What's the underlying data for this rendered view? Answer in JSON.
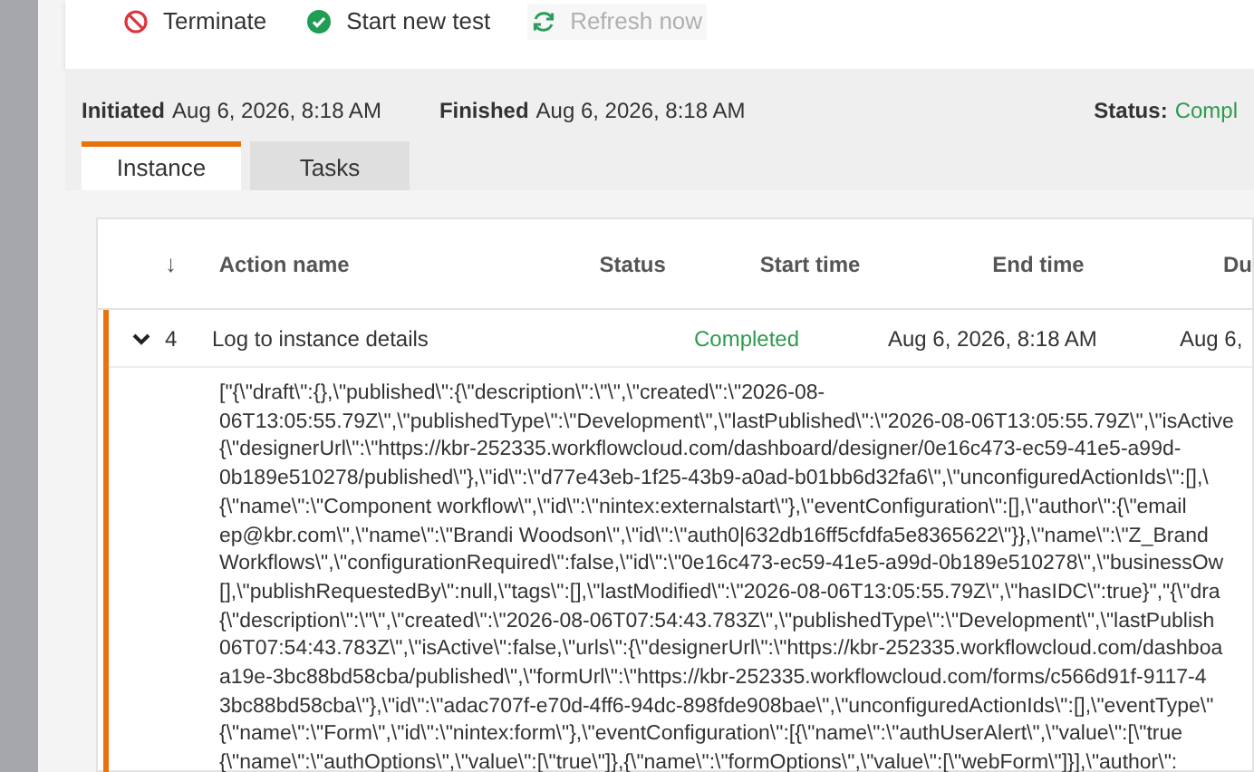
{
  "toolbar": [
    {
      "kind": "terminate",
      "label": "Terminate",
      "disabled": false
    },
    {
      "kind": "start",
      "label": "Start new test",
      "disabled": false
    },
    {
      "kind": "refresh",
      "label": "Refresh now",
      "disabled": true
    }
  ],
  "summary": {
    "initiated_label": "Initiated",
    "initiated": "Aug 6, 2026, 8:18 AM",
    "finished_label": "Finished",
    "finished": "Aug 6, 2026, 8:18 AM",
    "status_label": "Status:",
    "status": "Compl"
  },
  "tabs": [
    {
      "label": "Instance",
      "selected": true
    },
    {
      "label": "Tasks",
      "selected": false
    }
  ],
  "table": {
    "sort_icon": "↓",
    "columns": [
      "Action name",
      "Status",
      "Start time",
      "End time",
      "Du"
    ],
    "rows": [
      {
        "expanded": true,
        "number": "4",
        "action": "Log to instance details",
        "status": "Completed",
        "start": "Aug 6, 2026, 8:18 AM",
        "end": "Aug 6,",
        "details": [
          "[\"{\\\"draft\\\":{},\\\"published\\\":{\\\"description\\\":\\\"\\\",\\\"created\\\":\\\"2026-08-",
          "06T13:05:55.79Z\\\",\\\"publishedType\\\":\\\"Development\\\",\\\"lastPublished\\\":\\\"2026-08-06T13:05:55.79Z\\\",\\\"isActive",
          "{\\\"designerUrl\\\":\\\"https://kbr-252335.workflowcloud.com/dashboard/designer/0e16c473-ec59-41e5-a99d-",
          "0b189e510278/published\\\"},\\\"id\\\":\\\"d77e43eb-1f25-43b9-a0ad-b01bb6d32fa6\\\",\\\"unconfiguredActionIds\\\":[],\\",
          "{\\\"name\\\":\\\"Component workflow\\\",\\\"id\\\":\\\"nintex:externalstart\\\"},\\\"eventConfiguration\\\":[],\\\"author\\\":{\\\"email",
          "ep@kbr.com\\\",\\\"name\\\":\\\"Brandi Woodson\\\",\\\"id\\\":\\\"auth0|632db16ff5cfdfa5e8365622\\\"}},\\\"name\\\":\\\"Z_Brand",
          "Workflows\\\",\\\"configurationRequired\\\":false,\\\"id\\\":\\\"0e16c473-ec59-41e5-a99d-0b189e510278\\\",\\\"businessOw",
          "[],\\\"publishRequestedBy\\\":null,\\\"tags\\\":[],\\\"lastModified\\\":\\\"2026-08-06T13:05:55.79Z\\\",\\\"hasIDC\\\":true}\",\"{\\\"dra",
          "{\\\"description\\\":\\\"\\\",\\\"created\\\":\\\"2026-08-06T07:54:43.783Z\\\",\\\"publishedType\\\":\\\"Development\\\",\\\"lastPublish",
          "06T07:54:43.783Z\\\",\\\"isActive\\\":false,\\\"urls\\\":{\\\"designerUrl\\\":\\\"https://kbr-252335.workflowcloud.com/dashboa",
          "a19e-3bc88bd58cba/published\\\",\\\"formUrl\\\":\\\"https://kbr-252335.workflowcloud.com/forms/c566d91f-9117-4",
          "3bc88bd58cba\\\"},\\\"id\\\":\\\"adac707f-e70d-4ff6-94dc-898fde908bae\\\",\\\"unconfiguredActionIds\\\":[],\\\"eventType\\\"",
          "{\\\"name\\\":\\\"Form\\\",\\\"id\\\":\\\"nintex:form\\\"},\\\"eventConfiguration\\\":[{\\\"name\\\":\\\"authUserAlert\\\",\\\"value\\\":[\\\"true",
          "{\\\"name\\\":\\\"authOptions\\\",\\\"value\\\":[\\\"true\\\"]},{\\\"name\\\":\\\"formOptions\\\",\\\"value\\\":[\\\"webForm\\\"]}],\\\"author\\\":"
        ]
      }
    ]
  }
}
